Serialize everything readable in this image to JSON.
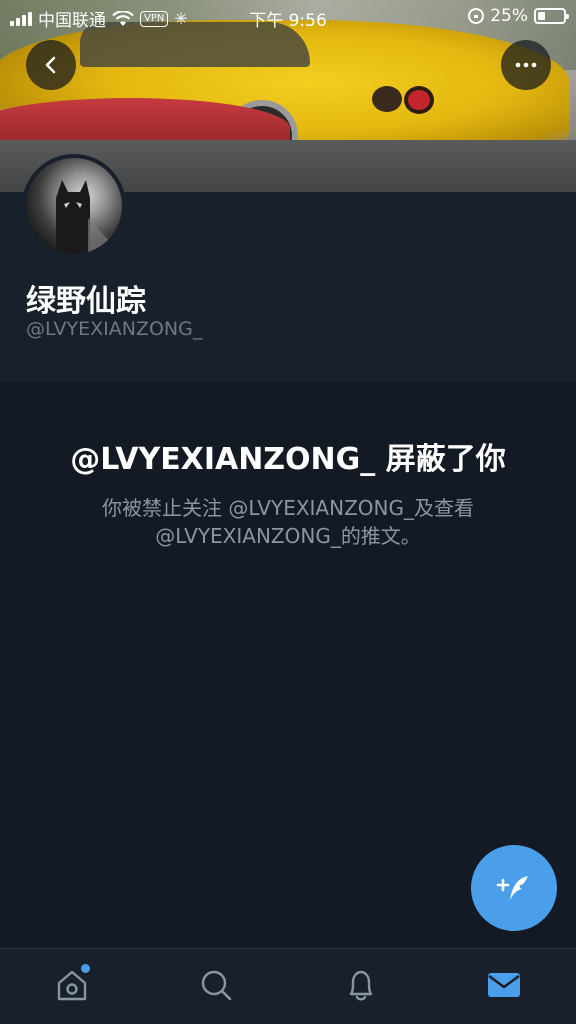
{
  "status_bar": {
    "carrier": "中国联通",
    "vpn": "VPN",
    "time": "下午 9:56",
    "battery": "25%"
  },
  "profile": {
    "display_name": "绿野仙踪",
    "handle": "@LVYEXIANZONG_"
  },
  "blocked": {
    "title": "@LVYEXIANZONG_ 屏蔽了你",
    "description": "你被禁止关注 @LVYEXIANZONG_及查看 @LVYEXIANZONG_的推文。"
  },
  "icons": {
    "back": "chevron-left-icon",
    "more": "more-dots-icon",
    "compose": "compose-tweet-icon",
    "home": "home-icon",
    "search": "search-icon",
    "notifications": "bell-icon",
    "messages": "mail-icon"
  },
  "colors": {
    "accent": "#4a9eea",
    "background": "#141a23",
    "panel": "#18202b",
    "muted_text": "#8b96a3",
    "handle_text": "#6e7884"
  }
}
